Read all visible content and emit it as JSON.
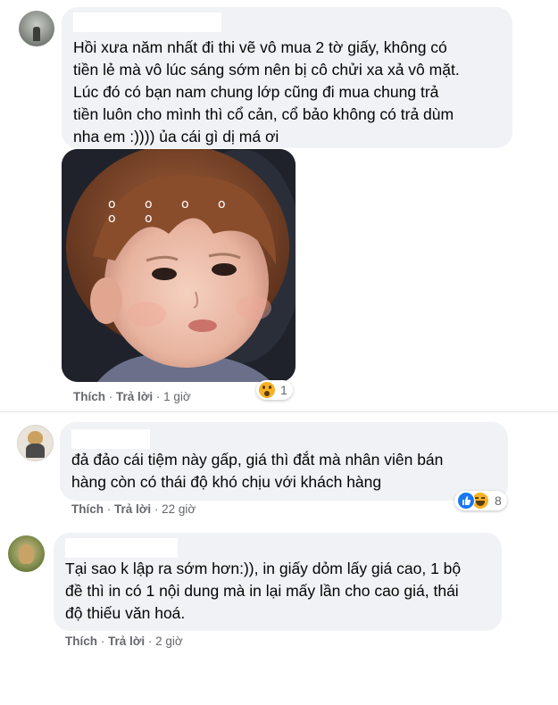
{
  "comments": [
    {
      "text": "Hồi xưa năm nhất đi thi vẽ vô mua 2 tờ giấy, không có\ntiền lẻ mà vô lúc sáng sớm nên bị cô chửi xa xả vô mặt.\nLúc đó có bạn nam chung lớp cũng đi mua chung trả\ntiền luôn cho mình thì cổ cản, cổ bảo không có trả dùm\nnha em :)))) ủa cái gì dị má ơi",
      "image_dots": "o o o o o o",
      "like_label": "Thích",
      "reply_label": "Trả lời",
      "time": "1 giờ",
      "reaction_count": "1",
      "reaction_icons": [
        "wow-icon"
      ]
    },
    {
      "text": "đả đảo cái tiệm này gấp, giá thì đắt mà nhân viên bán\nhàng còn có thái độ khó chịu với khách hàng",
      "like_label": "Thích",
      "reply_label": "Trả lời",
      "time": "22 giờ",
      "reaction_count": "8",
      "reaction_icons": [
        "like-icon",
        "haha-icon"
      ]
    },
    {
      "text": "Tại sao k lập ra sớm hơn:)), in giấy dỏm lấy giá cao, 1 bộ\nđề thì in có 1 nội dung mà in lại mấy lần cho cao giá, thái\nđộ thiếu văn hoá.",
      "like_label": "Thích",
      "reply_label": "Trả lời",
      "time": "2 giờ"
    }
  ],
  "separator": " · ",
  "colors": {
    "bubble": "#f0f2f5",
    "meta": "#65676b",
    "like_blue": "#1877f2",
    "reaction_yellow": "#f7b125"
  }
}
